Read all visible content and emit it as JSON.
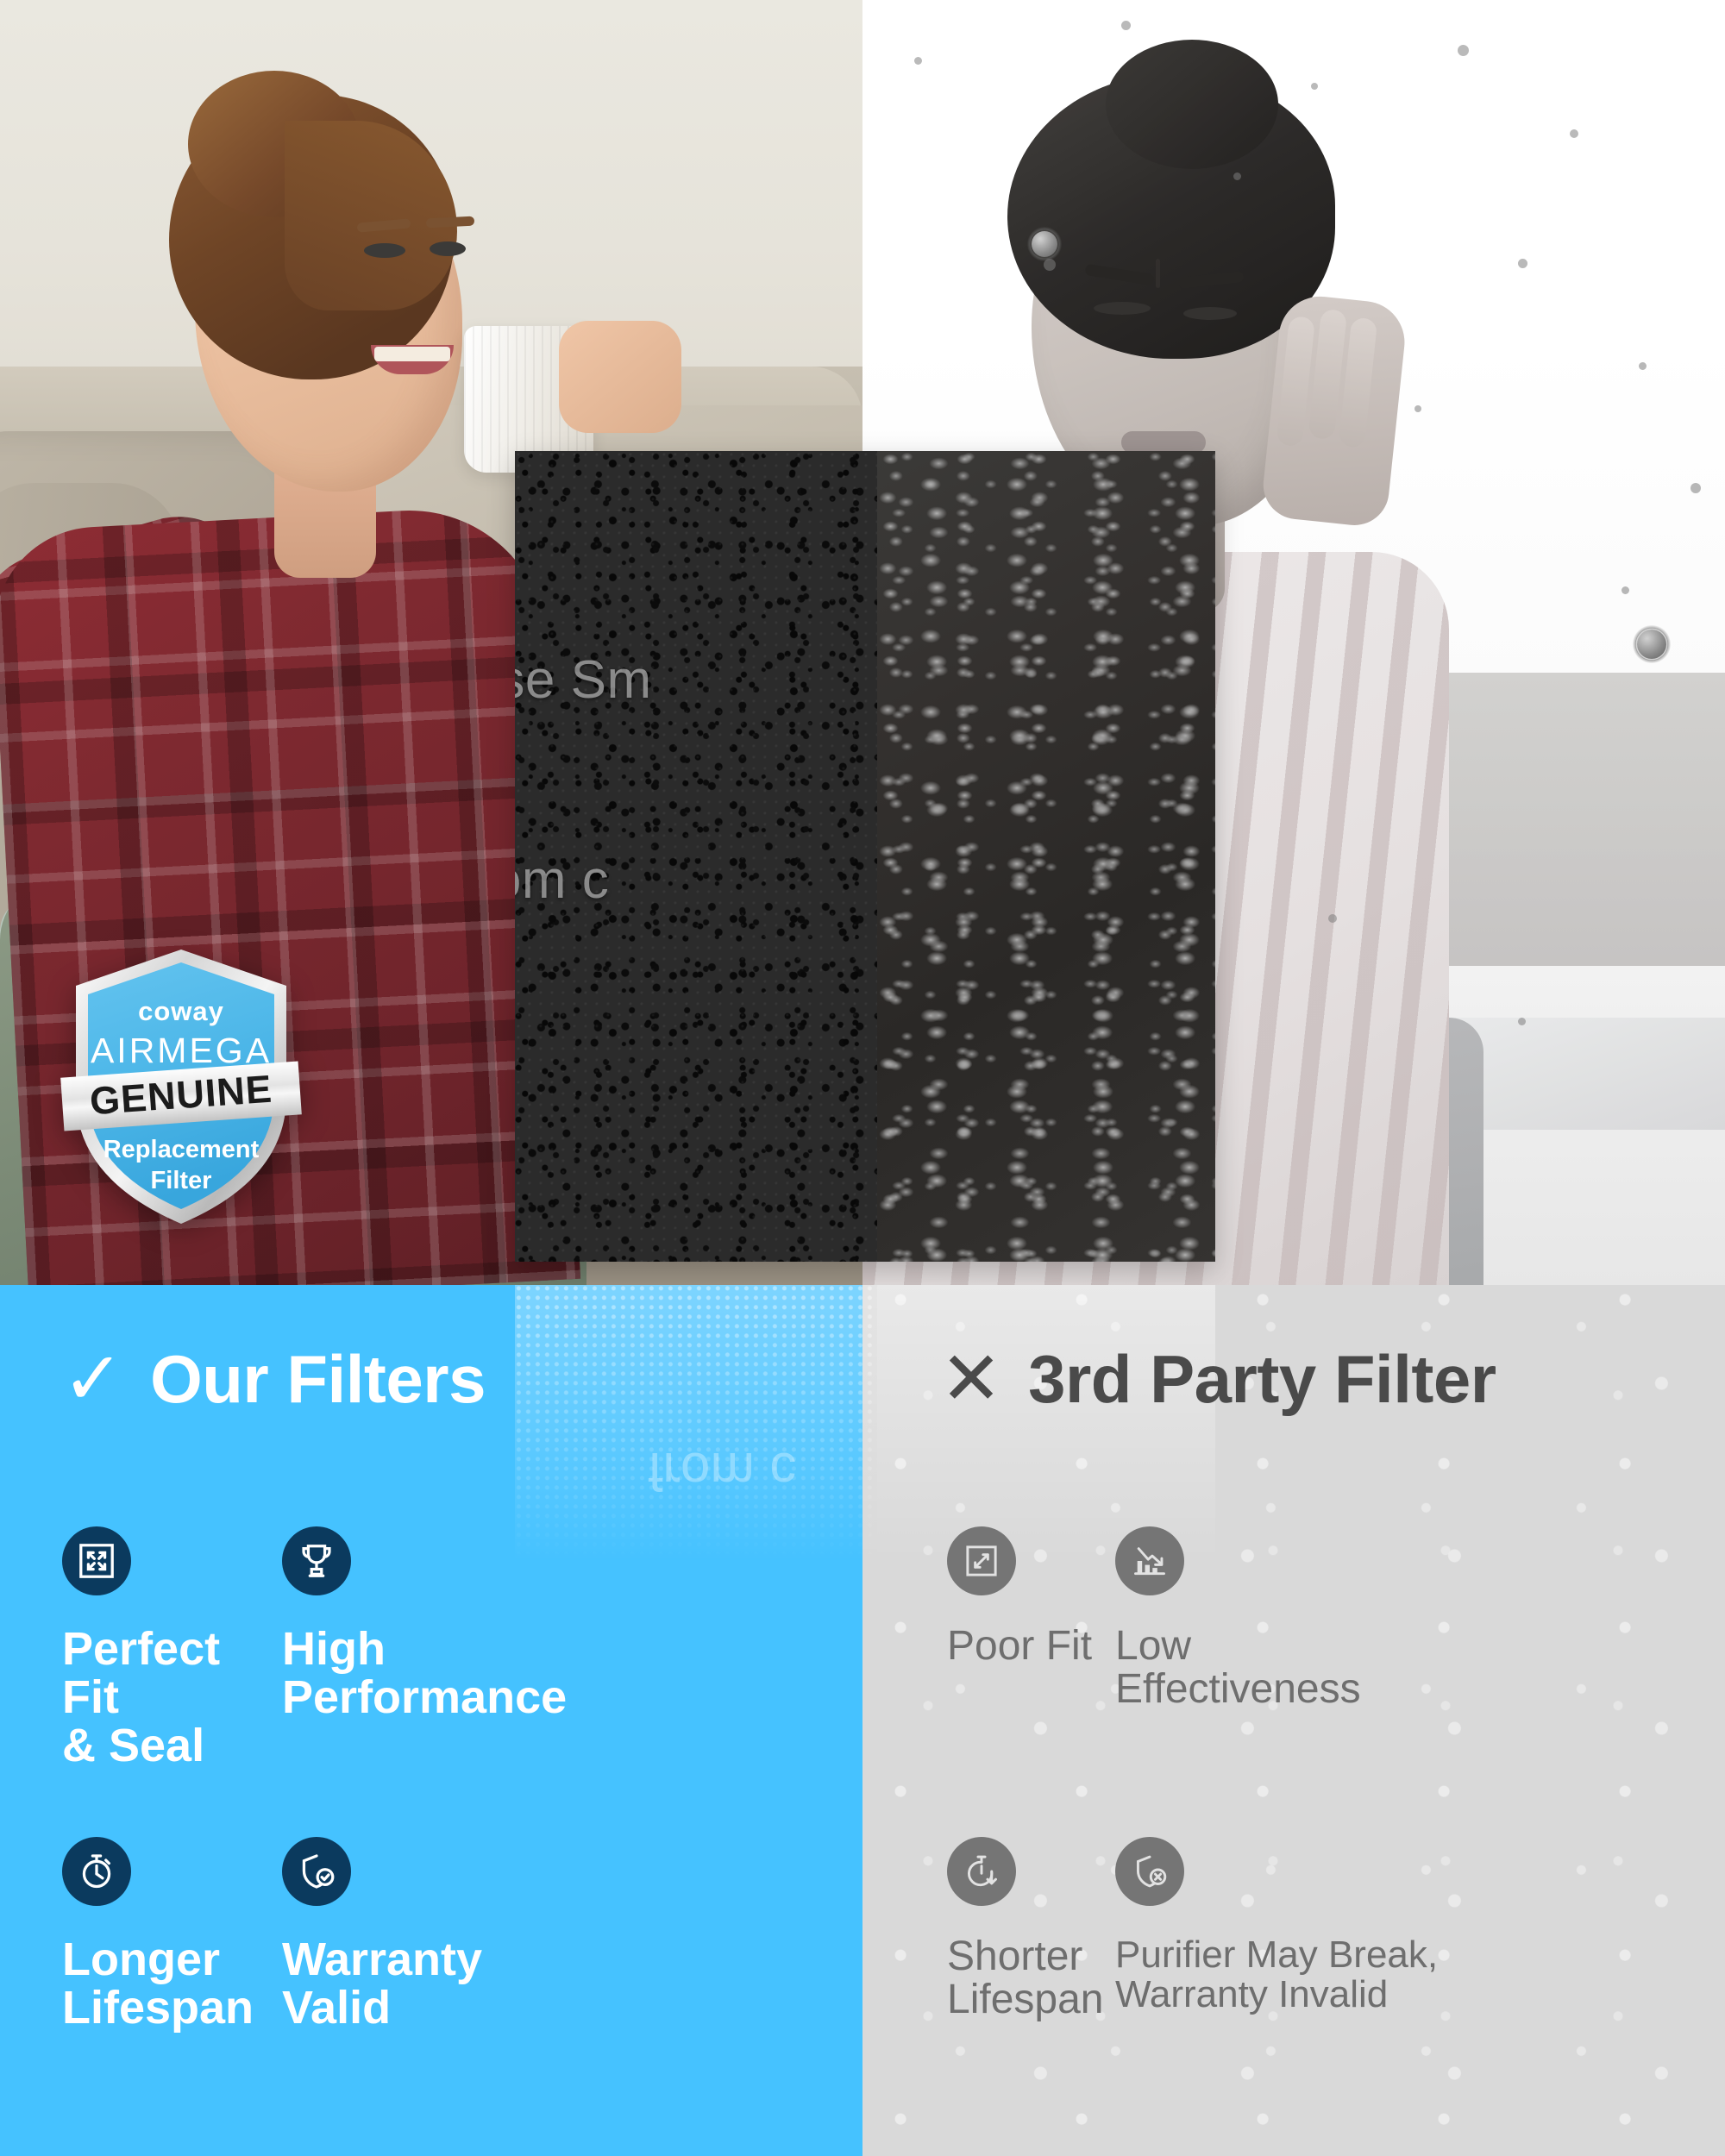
{
  "badge": {
    "brand": "coway",
    "product_line": "AIRMEGA",
    "banner": "GENUINE",
    "line1": "Replacement",
    "line2": "Filter"
  },
  "filter_panel": {
    "overlay_line1": "Intense Sm",
    "overlay_line2": "from c",
    "reflection_text": "from c"
  },
  "comparison": {
    "left": {
      "mark": "✓",
      "title": "Our Filters",
      "accent_color": "#45c2ff",
      "icon_color": "#0b3a5e",
      "text_color": "#ffffff",
      "features": [
        {
          "icon": "expand-fit-icon",
          "label": "Perfect Fit\n& Seal"
        },
        {
          "icon": "trophy-icon",
          "label": "High\nPerformance"
        },
        {
          "icon": "stopwatch-icon",
          "label": "Longer\nLifespan"
        },
        {
          "icon": "shield-check-icon",
          "label": "Warranty\nValid"
        }
      ]
    },
    "right": {
      "mark": "✕",
      "title": "3rd Party Filter",
      "accent_color": "#d9d9d9",
      "icon_color": "#757575",
      "text_color": "#6e6e6e",
      "features": [
        {
          "icon": "shrink-fit-icon",
          "label": "Poor Fit"
        },
        {
          "icon": "declining-chart-icon",
          "label": "Low\nEffectiveness"
        },
        {
          "icon": "stopwatch-down-icon",
          "label": "Shorter\nLifespan"
        },
        {
          "icon": "shield-x-icon",
          "label": "Purifier May Break,\nWarranty Invalid"
        }
      ]
    }
  }
}
